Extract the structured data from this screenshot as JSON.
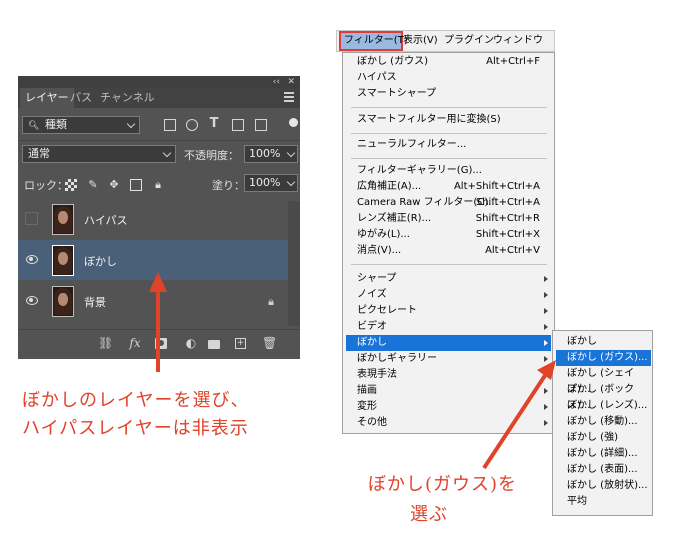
{
  "layers_panel": {
    "collapse_glyph": "‹‹",
    "close_glyph": "✕",
    "tabs": [
      "レイヤー",
      "パス",
      "チャンネル"
    ],
    "filter_kind": "種類",
    "filter_icons": [
      "image-filter-icon",
      "adjustment-filter-icon",
      "type-filter-icon",
      "shape-filter-icon",
      "smart-object-filter-icon"
    ],
    "blend_mode": "通常",
    "opacity_label": "不透明度：",
    "opacity_value": "100%",
    "lock_label": "ロック：",
    "fill_label": "塗り：",
    "fill_value": "100%",
    "layers": [
      {
        "name": "ハイパス",
        "visible": false,
        "selected": false
      },
      {
        "name": "ぼかし",
        "visible": true,
        "selected": true
      },
      {
        "name": "背景",
        "visible": true,
        "selected": false,
        "locked": true
      }
    ],
    "bottom_icons": [
      "link-icon",
      "fx-icon",
      "mask-icon",
      "adjustment-icon",
      "folder-icon",
      "new-layer-icon",
      "trash-icon"
    ],
    "fx_label": "fx"
  },
  "menubar": {
    "items": [
      "フィルター(T)",
      "表示(V)",
      "プラグイン",
      "ウィンドウ(W)"
    ]
  },
  "filter_menu": {
    "groups": [
      [
        {
          "label": "ぼかし (ガウス)",
          "shortcut": "Alt+Ctrl+F"
        },
        {
          "label": "ハイパス",
          "shortcut": ""
        },
        {
          "label": "スマートシャープ",
          "shortcut": ""
        }
      ],
      [
        {
          "label": "スマートフィルター用に変換(S)",
          "shortcut": ""
        }
      ],
      [
        {
          "label": "ニューラルフィルター...",
          "shortcut": ""
        }
      ],
      [
        {
          "label": "フィルターギャラリー(G)...",
          "shortcut": ""
        },
        {
          "label": "広角補正(A)...",
          "shortcut": "Alt+Shift+Ctrl+A"
        },
        {
          "label": "Camera Raw フィルター(C)...",
          "shortcut": "Shift+Ctrl+A"
        },
        {
          "label": "レンズ補正(R)...",
          "shortcut": "Shift+Ctrl+R"
        },
        {
          "label": "ゆがみ(L)...",
          "shortcut": "Shift+Ctrl+X"
        },
        {
          "label": "消点(V)...",
          "shortcut": "Alt+Ctrl+V"
        }
      ],
      [
        {
          "label": "シャープ",
          "submenu": true
        },
        {
          "label": "ノイズ",
          "submenu": true
        },
        {
          "label": "ピクセレート",
          "submenu": true
        },
        {
          "label": "ビデオ",
          "submenu": true
        },
        {
          "label": "ぼかし",
          "submenu": true,
          "highlighted": true
        },
        {
          "label": "ぼかしギャラリー",
          "submenu": true
        },
        {
          "label": "表現手法",
          "submenu": true
        },
        {
          "label": "描画",
          "submenu": true
        },
        {
          "label": "変形",
          "submenu": true
        },
        {
          "label": "その他",
          "submenu": true
        }
      ]
    ]
  },
  "blur_submenu": {
    "items": [
      "ぼかし",
      "ぼかし (ガウス)...",
      "ぼかし (シェイプ)...",
      "ぼかし (ボックス)...",
      "ぼかし (レンズ)...",
      "ぼかし (移動)...",
      "ぼかし (強)",
      "ぼかし (詳細)...",
      "ぼかし (表面)...",
      "ぼかし (放射状)...",
      "平均"
    ],
    "highlighted_index": 1
  },
  "annotations": {
    "left_line1": "ぼかしのレイヤーを選び、",
    "left_line2": "ハイパスレイヤーは非表示",
    "right_line1": "ぼかし(ガウス)を",
    "right_line2": "選ぶ",
    "color": "#e0422a"
  },
  "colors": {
    "panel_bg": "#535353",
    "selected_layer": "#4a6078",
    "menu_highlight": "#1a74d8",
    "annotation": "#e0422a"
  }
}
